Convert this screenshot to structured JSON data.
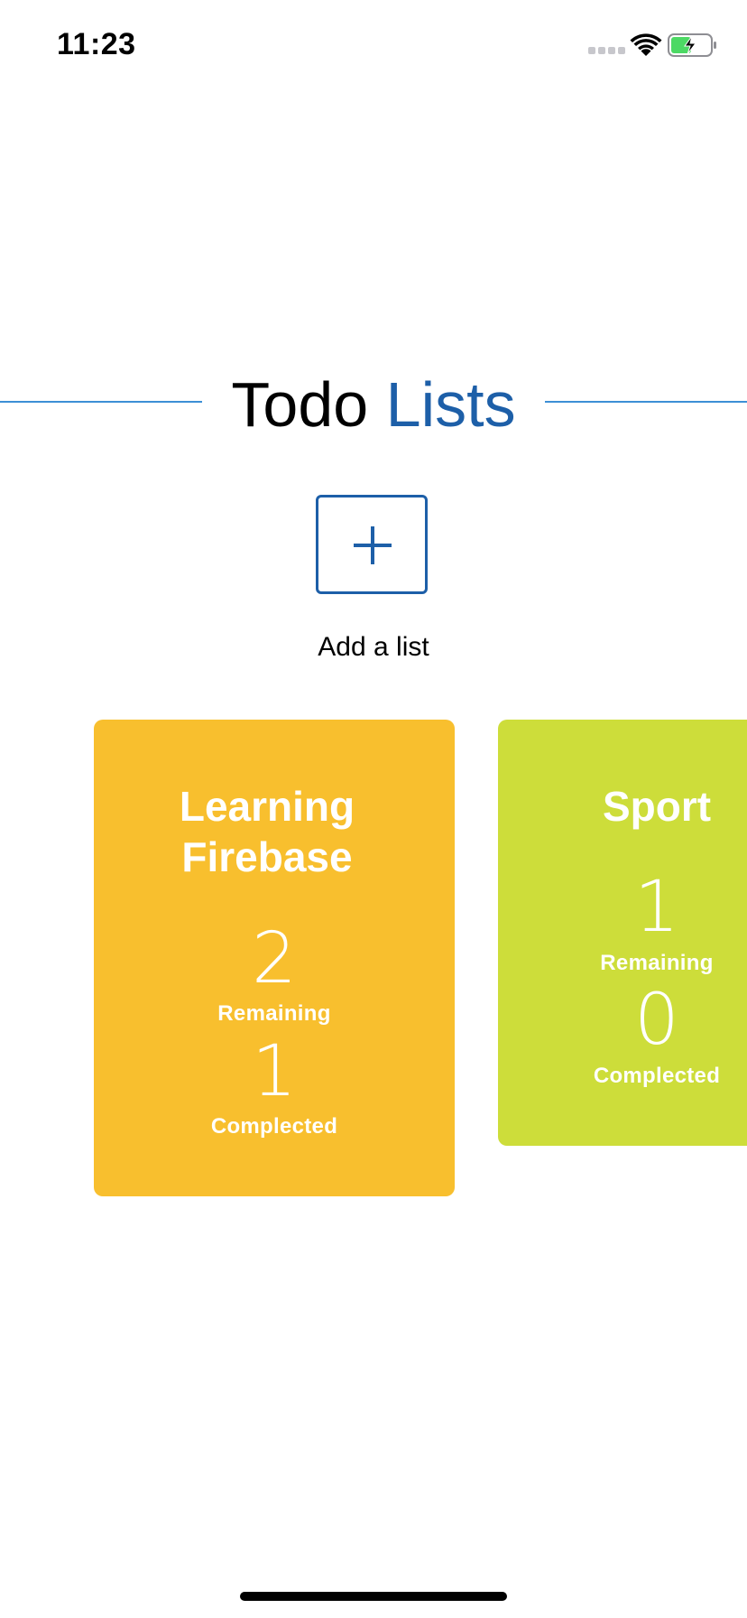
{
  "status_bar": {
    "time": "11:23",
    "battery_state": "charging"
  },
  "header": {
    "title_primary": "Todo",
    "title_accent": "Lists"
  },
  "add_list": {
    "icon": "plus-icon",
    "label": "Add a list"
  },
  "lists": [
    {
      "name": "Learning Firebase",
      "color": "#f8bf2e",
      "remaining_count": "2",
      "remaining_label": "Remaining",
      "completed_count": "1",
      "completed_label": "Complected"
    },
    {
      "name": "Sport",
      "color": "#cddd3a",
      "remaining_count": "1",
      "remaining_label": "Remaining",
      "completed_count": "0",
      "completed_label": "Complected"
    }
  ],
  "colors": {
    "accent": "#1d5fa8",
    "divider": "#3d8fd6"
  }
}
